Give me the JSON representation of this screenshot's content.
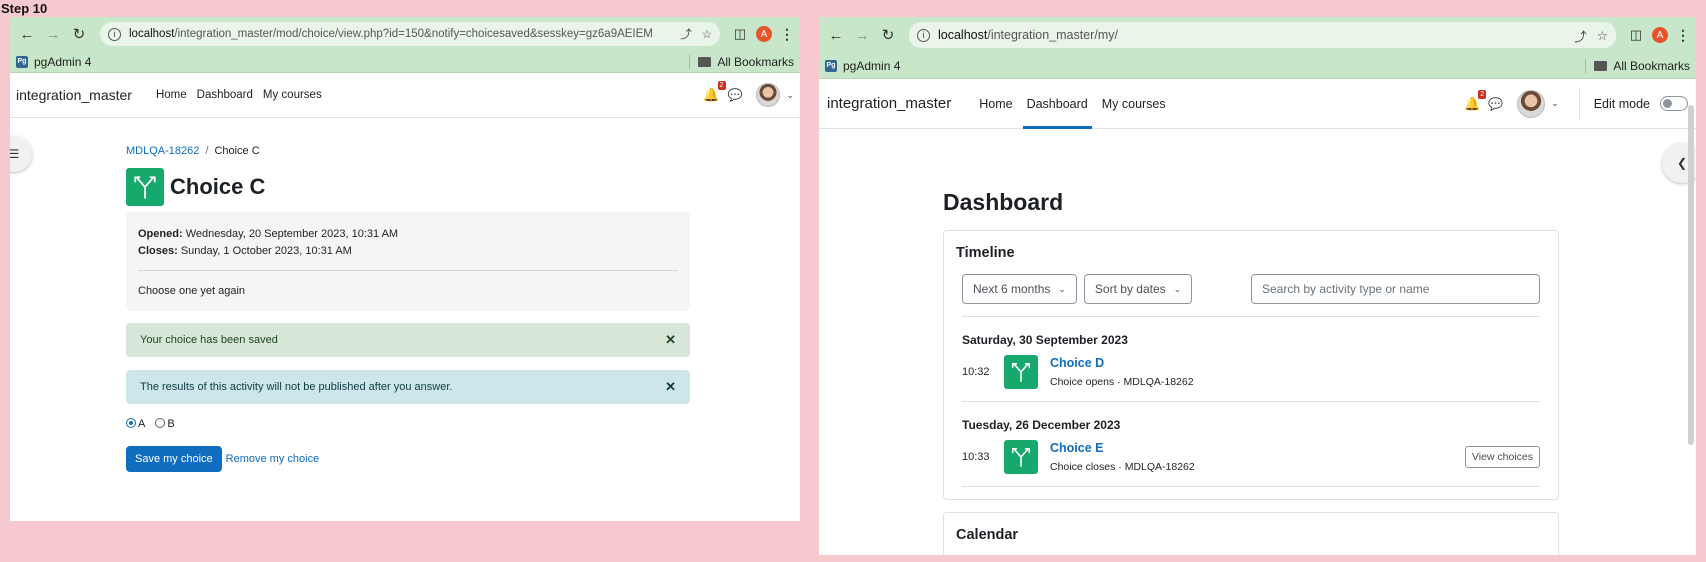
{
  "step_label": "Step 10",
  "left": {
    "url_host": "localhost",
    "url_path": "/integration_master/mod/choice/view.php?id=150&notify=choicesaved&sesskey=gz6a9AEIEM",
    "profile_initial": "A",
    "bookmark_pgadmin": "pgAdmin 4",
    "bookmark_all": "All Bookmarks",
    "site_name": "integration_master",
    "nav": [
      "Home",
      "Dashboard",
      "My courses"
    ],
    "notification_count": "2",
    "breadcrumb": {
      "course": "MDLQA-18262",
      "separator": "/",
      "current": "Choice C"
    },
    "title": "Choice C",
    "opened_label": "Opened:",
    "opened_value": "Wednesday, 20 September 2023, 10:31 AM",
    "closes_label": "Closes:",
    "closes_value": "Sunday, 1 October 2023, 10:31 AM",
    "description": "Choose one yet again",
    "alert_saved": "Your choice has been saved",
    "alert_results": "The results of this activity will not be published after you answer.",
    "options": [
      "A",
      "B"
    ],
    "selected_option": "A",
    "save_button": "Save my choice",
    "remove_link": "Remove my choice"
  },
  "right": {
    "url_host": "localhost",
    "url_path": "/integration_master/my/",
    "profile_initial": "A",
    "bookmark_pgadmin": "pgAdmin 4",
    "bookmark_all": "All Bookmarks",
    "site_name": "integration_master",
    "nav": [
      "Home",
      "Dashboard",
      "My courses"
    ],
    "active_nav": "Dashboard",
    "notification_count": "2",
    "edit_mode_label": "Edit mode",
    "page_title": "Dashboard",
    "timeline": {
      "title": "Timeline",
      "filter": "Next 6 months",
      "sort": "Sort by dates",
      "search_placeholder": "Search by activity type or name",
      "groups": [
        {
          "date": "Saturday, 30 September 2023",
          "time": "10:32",
          "name": "Choice D",
          "sub": "Choice opens · MDLQA-18262",
          "action": ""
        },
        {
          "date": "Tuesday, 26 December 2023",
          "time": "10:33",
          "name": "Choice E",
          "sub": "Choice closes · MDLQA-18262",
          "action": "View choices"
        }
      ]
    },
    "calendar_title": "Calendar"
  }
}
